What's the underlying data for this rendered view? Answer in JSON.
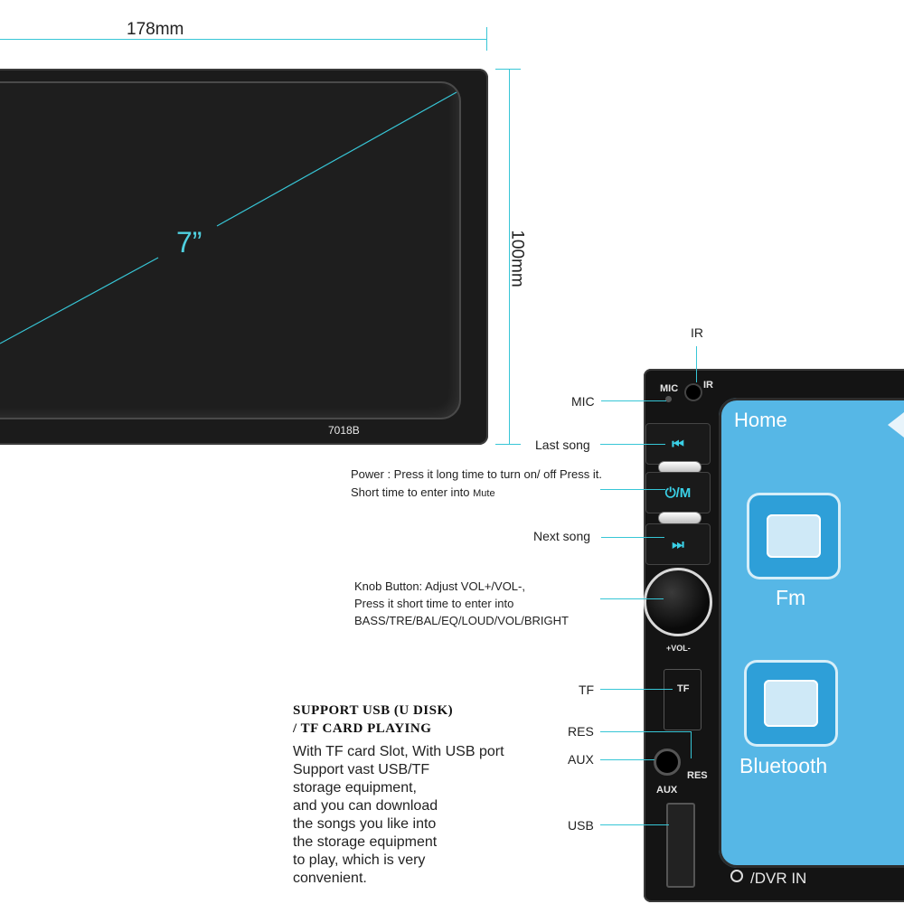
{
  "dimensions": {
    "width": "178mm",
    "height": "100mm",
    "diagonal": "7”"
  },
  "model": "7018B",
  "labels": {
    "ir": "IR",
    "mic": "MIC",
    "last_song": "Last song",
    "power_line1": "Power : Press it long time to turn on/ off Press it.",
    "power_line2": "Short time to enter into",
    "power_mute": "Mute",
    "next_song": "Next song",
    "knob_line1": "Knob Button: Adjust VOL+/VOL-,",
    "knob_line2": "Press it short time to enter into",
    "knob_line3": "BASS/TRE/BAL/EQ/LOUD/VOL/BRIGHT",
    "tf": "TF",
    "res": "RES",
    "aux": "AUX",
    "usb": "USB"
  },
  "device": {
    "mic": "MIC",
    "ir": "IR",
    "power_mode": "⏻/M",
    "vol": "+VOL-",
    "tf": "TF",
    "res": "RES",
    "aux": "AUX",
    "dvr": "/DVR IN"
  },
  "screen_ui": {
    "home": "Home",
    "apps": [
      "Fm",
      "Bluetooth"
    ]
  },
  "support": {
    "title_line1": "SUPPORT USB (U DISK)",
    "title_line2": "/ TF CARD PLAYING",
    "body": [
      "With TF card Slot, With USB port",
      "Support vast USB/TF",
      "storage equipment,",
      "and you can download",
      "the songs you like into",
      "the storage equipment",
      "to play, which is very",
      "convenient."
    ]
  },
  "colors": {
    "accent": "#37c6d6",
    "lcd": "#56b7e6"
  }
}
